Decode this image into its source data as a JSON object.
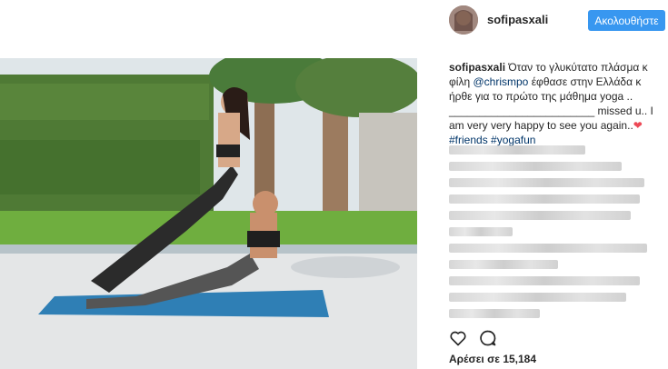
{
  "header": {
    "username": "sofipasxali",
    "follow_label": "Ακολουθήστε"
  },
  "caption": {
    "username": "sofipasxali",
    "text_part1": "Όταν το γλυκύτατο πλάσμα κ φίλη",
    "mention": "@chrismpo",
    "text_part2": "έφθασε στην Ελλάδα κ ήρθε για το πρώτο της μάθημα yoga ..",
    "text_part3": "________________________ missed u.. I am very very happy to see you again..",
    "heart": "❤",
    "hashtag1": "#friends",
    "hashtag2": "#yogafun"
  },
  "actions": {
    "like_icon": "heart-outline-icon",
    "comment_icon": "comment-bubble-icon"
  },
  "likes": {
    "text": "Αρέσει σε 15,184"
  },
  "colors": {
    "follow_button": "#3897f0",
    "link": "#003569",
    "heart": "#ed4956"
  }
}
